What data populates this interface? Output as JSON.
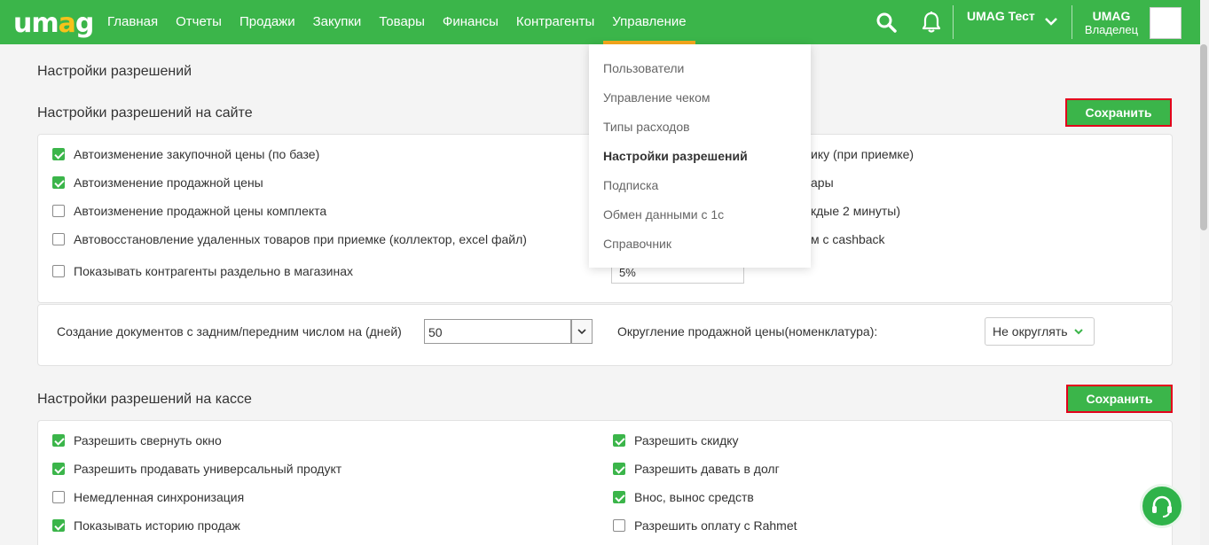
{
  "logo": {
    "text_u": "u",
    "text_m": "m",
    "text_a": "a",
    "text_g": "g"
  },
  "nav": [
    "Главная",
    "Отчеты",
    "Продажи",
    "Закупки",
    "Товары",
    "Финансы",
    "Контрагенты",
    "Управление"
  ],
  "header": {
    "store": "UMAG Тест",
    "user_name": "UMAG",
    "user_role": "Владелец"
  },
  "page_title": "Настройки разрешений",
  "site_section": {
    "title": "Настройки разрешений на сайте",
    "save_label": "Сохранить",
    "left_options": [
      {
        "label": "Автоизменение закупочной цены (по базе)",
        "checked": true
      },
      {
        "label": "Автоизменение продажной цены",
        "checked": true
      },
      {
        "label": "Автоизменение продажной цены комплекта",
        "checked": false
      },
      {
        "label": "Автовосстановление удаленных товаров при приемке (коллектор, excel файл)",
        "checked": false
      },
      {
        "label": "Показывать контрагенты раздельно в магазинах",
        "checked": false
      }
    ],
    "right_fragments": [
      "ику (при приемке)",
      "ары",
      "кдые 2 минуты)",
      "м с cashback"
    ],
    "percent_value": "5%",
    "days_label": "Создание документов с задним/передним числом на (дней)",
    "days_value": "50",
    "rounding_label": "Округление продажной цены(номенклатура):",
    "rounding_value": "Не округлять"
  },
  "cash_section": {
    "title": "Настройки разрешений на кассе",
    "save_label": "Сохранить",
    "left_options": [
      {
        "label": "Разрешить свернуть окно",
        "checked": true
      },
      {
        "label": "Разрешить продавать универсальный продукт",
        "checked": true
      },
      {
        "label": "Немедленная синхронизация",
        "checked": false
      },
      {
        "label": "Показывать историю продаж",
        "checked": true
      }
    ],
    "right_options": [
      {
        "label": "Разрешить скидку",
        "checked": true
      },
      {
        "label": "Разрешить давать в долг",
        "checked": true
      },
      {
        "label": "Внос, вынос средств",
        "checked": true
      },
      {
        "label": "Разрешить оплату с Rahmet",
        "checked": false
      }
    ]
  },
  "dropdown": {
    "items": [
      "Пользователи",
      "Управление чеком",
      "Типы расходов",
      "Настройки разрешений",
      "Подписка",
      "Обмен данными с 1с",
      "Справочник"
    ],
    "active_index": 3
  },
  "colors": {
    "brand": "#3bb54a",
    "accent": "#f7a81c",
    "highlight": "#e3001b"
  }
}
